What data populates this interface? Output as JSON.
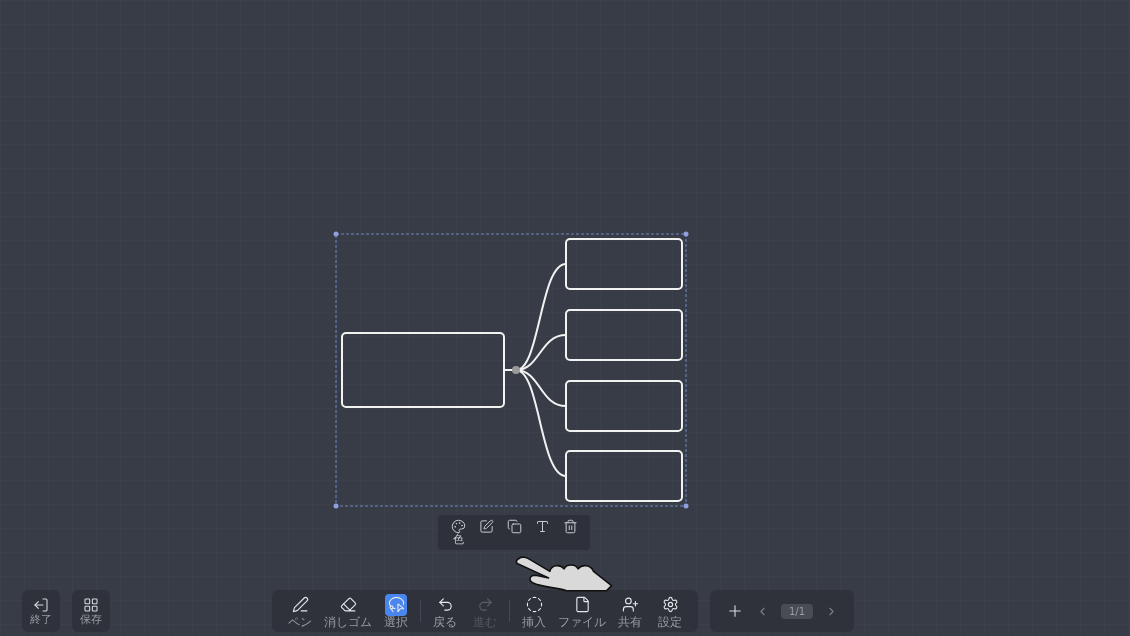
{
  "mind_map": {
    "selected": true
  },
  "context_menu": [
    {
      "kind": "labeled",
      "label": "色"
    },
    {
      "kind": "plain"
    },
    {
      "kind": "plain"
    },
    {
      "kind": "plain"
    },
    {
      "kind": "plain"
    }
  ],
  "left_buttons": [
    {
      "label": "終了"
    },
    {
      "label": "保存"
    }
  ],
  "tools": [
    {
      "kind": "tool",
      "label": "ペン",
      "selected": false,
      "disabled": false
    },
    {
      "kind": "tool",
      "label": "消しゴム",
      "selected": false,
      "disabled": false
    },
    {
      "kind": "tool",
      "label": "選択",
      "selected": true,
      "disabled": false
    },
    {
      "kind": "divider"
    },
    {
      "kind": "tool",
      "label": "戻る",
      "selected": false,
      "disabled": false
    },
    {
      "kind": "tool",
      "label": "進む",
      "selected": false,
      "disabled": true
    },
    {
      "kind": "divider"
    },
    {
      "kind": "tool",
      "label": "挿入",
      "selected": false,
      "disabled": false
    },
    {
      "kind": "tool",
      "label": "ファイル",
      "selected": false,
      "disabled": false
    },
    {
      "kind": "tool",
      "label": "共有",
      "selected": false,
      "disabled": false
    },
    {
      "kind": "tool",
      "label": "設定",
      "selected": false,
      "disabled": false
    }
  ],
  "pager": {
    "indicator": "1/1"
  }
}
